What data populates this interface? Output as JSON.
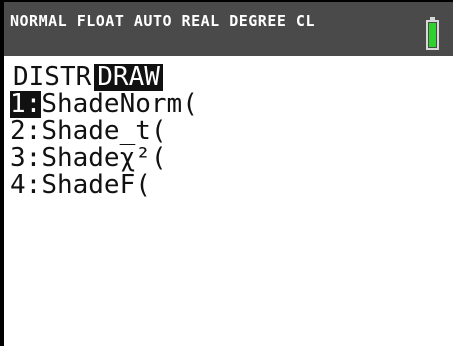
{
  "status_bar": {
    "text": "NORMAL FLOAT AUTO REAL DEGREE CL",
    "battery_icon": "battery-icon",
    "battery_color": "#2fd12f"
  },
  "menu": {
    "tabs": [
      {
        "label": "DISTR",
        "selected": false
      },
      {
        "label": "DRAW",
        "selected": true
      }
    ],
    "items": [
      {
        "num": "1:",
        "label": "ShadeNorm(",
        "selected": true
      },
      {
        "num": "2:",
        "label": "Shade_t(",
        "selected": false
      },
      {
        "num": "3:",
        "label": "Shadeχ²(",
        "selected": false
      },
      {
        "num": "4:",
        "label": "ShadeF(",
        "selected": false
      }
    ]
  }
}
